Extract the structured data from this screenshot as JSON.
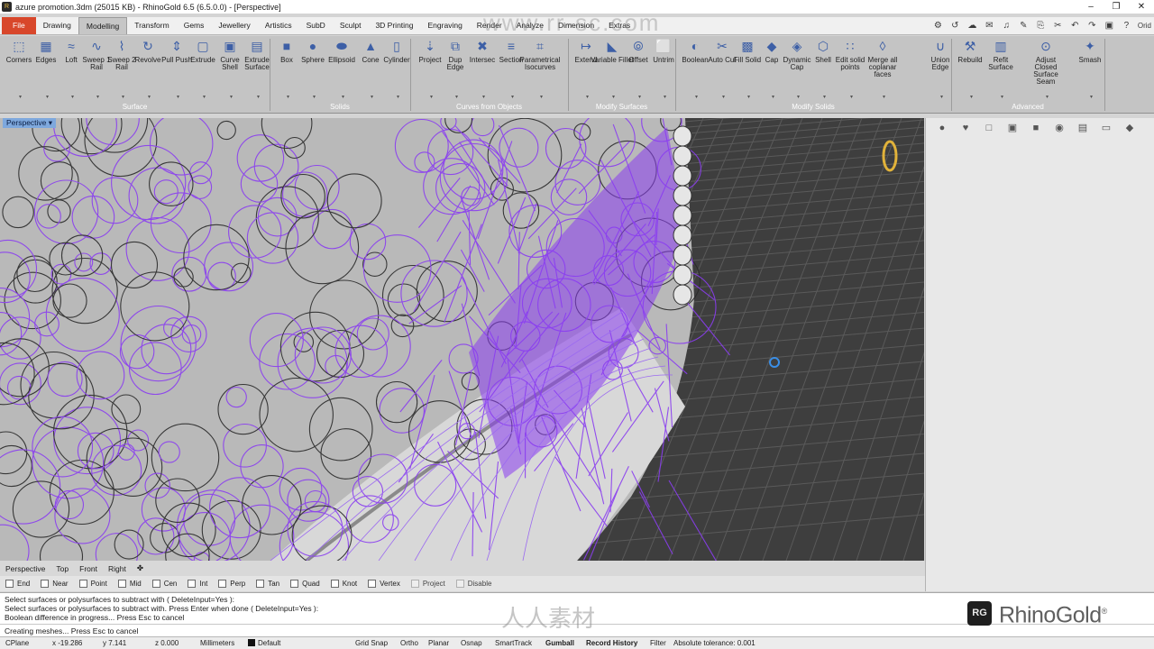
{
  "titlebar": {
    "title": "azure promotion.3dm (25015 KB) - RhinoGold 6.5 (6.5.0.0) - [Perspective]",
    "controls": [
      "–",
      "❐",
      "✕"
    ]
  },
  "menubar": {
    "file": "File",
    "tabs": [
      "Drawing",
      "Modelling",
      "Transform",
      "Gems",
      "Jewellery",
      "Artistics",
      "SubD",
      "Sculpt",
      "3D Printing",
      "Engraving",
      "Render",
      "Analyze",
      "Dimension",
      "Extras"
    ],
    "active_tab": "Modelling",
    "quick_icons": [
      "⚙",
      "↺",
      "☁",
      "✉",
      "♫",
      "✎",
      "⎘",
      "✂",
      "↶",
      "↷",
      "▣",
      "?"
    ],
    "help_label": "Orid"
  },
  "ribbon": {
    "tools": [
      {
        "label": "Corners",
        "icon": "⬚"
      },
      {
        "label": "Edges",
        "icon": "▦"
      },
      {
        "label": "Loft",
        "icon": "≈"
      },
      {
        "label": "Sweep 1 Rail",
        "icon": "∿"
      },
      {
        "label": "Sweep 2 Rail",
        "icon": "⌇"
      },
      {
        "label": "Revolve",
        "icon": "↻"
      },
      {
        "label": "Pull Push",
        "icon": "⇕"
      },
      {
        "label": "Extrude",
        "icon": "▢"
      },
      {
        "label": "Curve Shell",
        "icon": "▣"
      },
      {
        "label": "Extrude Surface",
        "icon": "▤"
      },
      {
        "label": "Box",
        "icon": "■"
      },
      {
        "label": "Sphere",
        "icon": "●"
      },
      {
        "label": "Ellipsoid",
        "icon": "⬬"
      },
      {
        "label": "Cone",
        "icon": "▲"
      },
      {
        "label": "Cylinder",
        "icon": "▯"
      },
      {
        "label": "Project",
        "icon": "⇣"
      },
      {
        "label": "Dup Edge",
        "icon": "⧉"
      },
      {
        "label": "Intersec",
        "icon": "✖"
      },
      {
        "label": "Section",
        "icon": "≡"
      },
      {
        "label": "Parametrical Isocurves",
        "icon": "⌗"
      },
      {
        "label": "Extend",
        "icon": "↦"
      },
      {
        "label": "Variable Fillet",
        "icon": "◣"
      },
      {
        "label": "Offset",
        "icon": "⦾"
      },
      {
        "label": "Untrim",
        "icon": "⬜"
      },
      {
        "label": "Boolean",
        "icon": "◐"
      },
      {
        "label": "Auto Cut",
        "icon": "✂"
      },
      {
        "label": "Fill Solid",
        "icon": "▩"
      },
      {
        "label": "Cap",
        "icon": "◆"
      },
      {
        "label": "Dynamic Cap",
        "icon": "◈"
      },
      {
        "label": "Shell",
        "icon": "⬡"
      },
      {
        "label": "Edit solid points",
        "icon": "∷"
      },
      {
        "label": "Merge all coplanar faces",
        "icon": "◊"
      },
      {
        "label": "Union Edge",
        "icon": "∪"
      },
      {
        "label": "Rebuild",
        "icon": "⚒"
      },
      {
        "label": "Refit Surface",
        "icon": "▥"
      },
      {
        "label": "Adjust Closed Surface Seam",
        "icon": "⊙"
      },
      {
        "label": "Smash",
        "icon": "✦"
      }
    ],
    "groups": [
      "Surface",
      "Solids",
      "Curves from Objects",
      "Modify Surfaces",
      "Modify Solids",
      "Advanced"
    ]
  },
  "viewport": {
    "label": "Perspective",
    "accent": "#8a3df0",
    "background": "#3e3e3e"
  },
  "right_panel": {
    "icons": [
      "●",
      "♥",
      "□",
      "▣",
      "■",
      "◉",
      "▤",
      "▭",
      "◆"
    ]
  },
  "viewport_tabs": [
    "Perspective",
    "Top",
    "Front",
    "Right",
    "✤"
  ],
  "osnaps": [
    {
      "label": "End",
      "on": true
    },
    {
      "label": "Near",
      "on": true
    },
    {
      "label": "Point",
      "on": true
    },
    {
      "label": "Mid",
      "on": true
    },
    {
      "label": "Cen",
      "on": true
    },
    {
      "label": "Int",
      "on": true
    },
    {
      "label": "Perp",
      "on": true
    },
    {
      "label": "Tan",
      "on": true
    },
    {
      "label": "Quad",
      "on": true
    },
    {
      "label": "Knot",
      "on": true
    },
    {
      "label": "Vertex",
      "on": true
    },
    {
      "label": "Project",
      "on": false
    },
    {
      "label": "Disable",
      "on": false
    }
  ],
  "command": {
    "history": [
      "Select surfaces or polysurfaces to subtract with ( DeleteInput=Yes ):",
      "Select surfaces or polysurfaces to subtract with. Press Enter when done ( DeleteInput=Yes ):",
      "Boolean difference in progress... Press Esc to cancel"
    ],
    "prompt": "Creating meshes... Press Esc to cancel",
    "logo_badge": "RG",
    "logo_text": "RhinoGold"
  },
  "status": {
    "cplane": "CPlane",
    "x": "x -19.286",
    "y": "y 7.141",
    "z": "z 0.000",
    "units": "Millimeters",
    "layer": "Default",
    "grid_snap": "Grid Snap",
    "ortho": "Ortho",
    "planar": "Planar",
    "osnap": "Osnap",
    "smarttrack": "SmartTrack",
    "gumball": "Gumball",
    "record_history": "Record History",
    "filter": "Filter",
    "tolerance": "Absolute tolerance: 0.001"
  },
  "watermark": {
    "top": "www.rr-sc.com",
    "bottom": "人人素材"
  }
}
